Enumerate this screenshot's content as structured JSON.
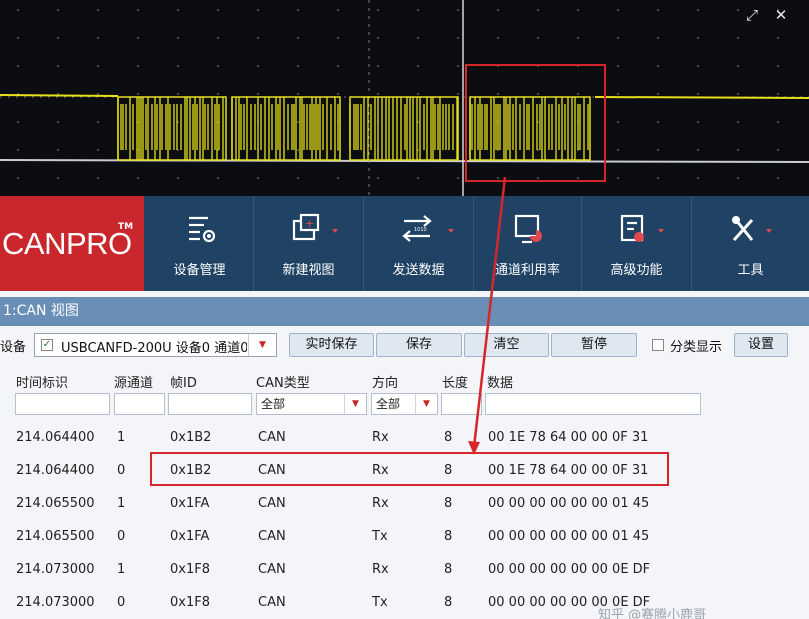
{
  "brand": {
    "name": "CANPRO",
    "tm": "TM"
  },
  "ribbon": {
    "buttons": [
      {
        "label": "设备管理",
        "icon": "device-settings-icon"
      },
      {
        "label": "新建视图",
        "icon": "new-view-icon"
      },
      {
        "label": "发送数据",
        "icon": "send-data-icon"
      },
      {
        "label": "通道利用率",
        "icon": "channel-usage-icon"
      },
      {
        "label": "高级功能",
        "icon": "advanced-icon"
      },
      {
        "label": "工具",
        "icon": "tools-icon"
      }
    ]
  },
  "view": {
    "title": "1:CAN 视图"
  },
  "toolbar": {
    "device_label": "设备",
    "device_value": "USBCANFD-200U 设备0 通道0",
    "realtime_save": "实时保存",
    "save": "保存",
    "clear": "清空",
    "pause": "暂停",
    "classify": "分类显示",
    "settings": "设置"
  },
  "table": {
    "headers": [
      "时间标识",
      "源通道",
      "帧ID",
      "CAN类型",
      "方向",
      "长度",
      "数据"
    ],
    "filters": {
      "can_type": "全部",
      "direction": "全部"
    },
    "rows": [
      {
        "time": "214.064400",
        "ch": "1",
        "id": "0x1B2",
        "type": "CAN",
        "dir": "Rx",
        "len": "8",
        "data": "00 1E 78 64 00 00 0F 31"
      },
      {
        "time": "214.064400",
        "ch": "0",
        "id": "0x1B2",
        "type": "CAN",
        "dir": "Rx",
        "len": "8",
        "data": "00 1E 78 64 00 00 0F 31"
      },
      {
        "time": "214.065500",
        "ch": "1",
        "id": "0x1FA",
        "type": "CAN",
        "dir": "Rx",
        "len": "8",
        "data": "00 00 00 00 00 00 01 45"
      },
      {
        "time": "214.065500",
        "ch": "0",
        "id": "0x1FA",
        "type": "CAN",
        "dir": "Tx",
        "len": "8",
        "data": "00 00 00 00 00 00 01 45"
      },
      {
        "time": "214.073000",
        "ch": "1",
        "id": "0x1F8",
        "type": "CAN",
        "dir": "Rx",
        "len": "8",
        "data": "00 00 00 00 00 00 0E DF"
      },
      {
        "time": "214.073000",
        "ch": "0",
        "id": "0x1F8",
        "type": "CAN",
        "dir": "Tx",
        "len": "8",
        "data": "00 00 00 00 00 00 0E DF"
      }
    ]
  },
  "colors": {
    "accent_red": "#d6262b",
    "trace_yellow": "#e8e01a",
    "ribbon_blue": "#1f4265"
  },
  "watermark": "知乎 @赛腾小鹿哥"
}
